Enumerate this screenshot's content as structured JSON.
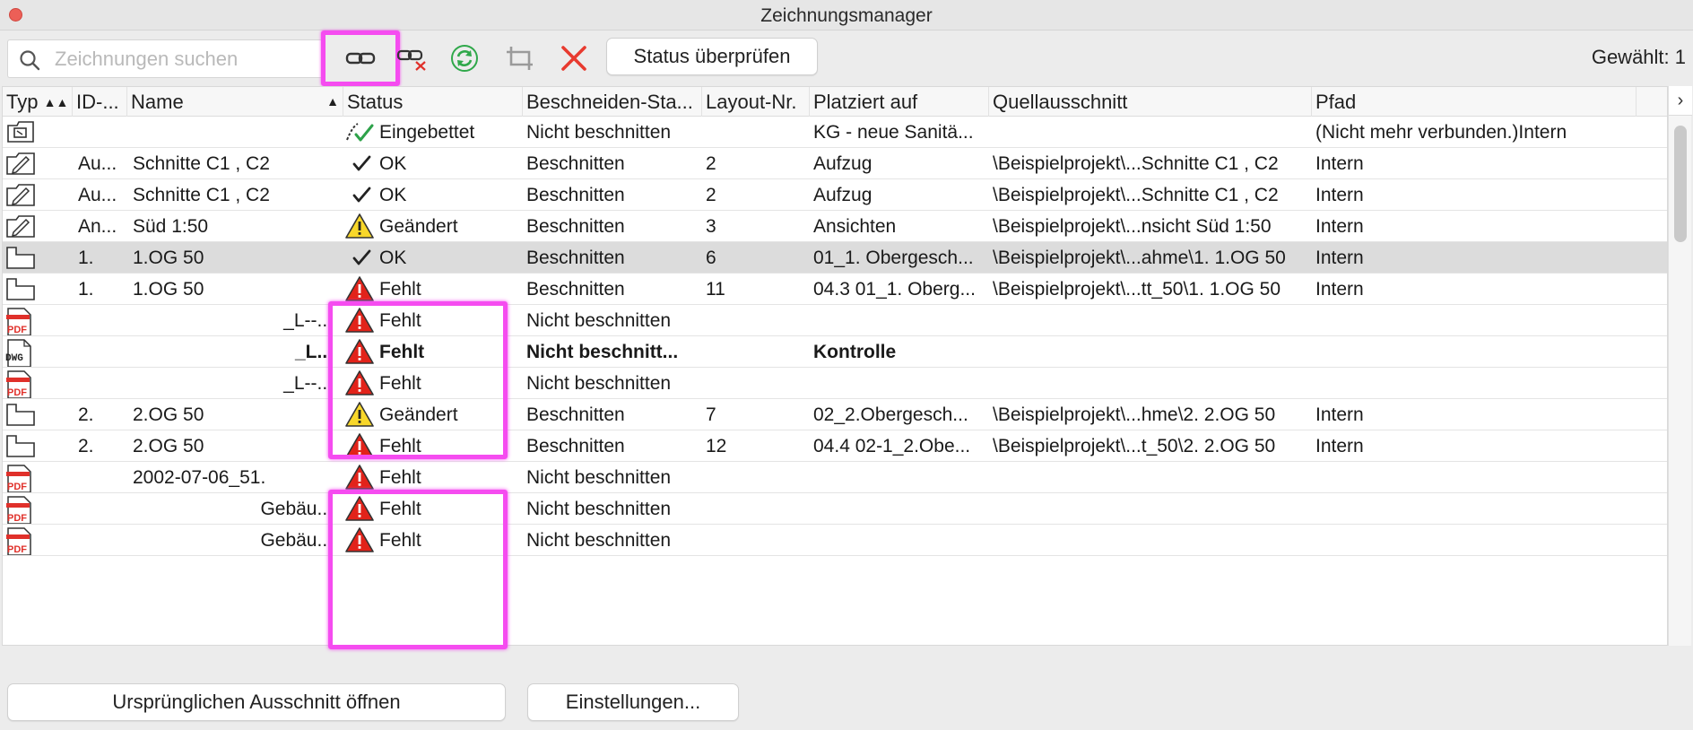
{
  "window": {
    "title": "Zeichnungsmanager"
  },
  "toolbar": {
    "search_placeholder": "Zeichnungen suchen",
    "status_button": "Status überprüfen",
    "selected_count": "Gewählt: 1",
    "tools": [
      "link-icon",
      "unlink-icon",
      "refresh-icon",
      "crop-icon",
      "delete-icon"
    ],
    "highlight_color": "#f54cf0"
  },
  "table": {
    "columns": [
      "Typ",
      "ID-...",
      "Name",
      "Status",
      "Beschneiden-Sta...",
      "Layout-Nr.",
      "Platziert auf",
      "Quellausschnitt",
      "Pfad"
    ],
    "rows": [
      {
        "type": "embedded",
        "id": "",
        "name": "",
        "status_icon": "embedded-check",
        "status": "Eingebettet",
        "crop": "Nicht beschnitten",
        "layout": "",
        "placed": "KG - neue Sanitä...",
        "source": "",
        "path": "(Nicht mehr verbunden.)Intern"
      },
      {
        "type": "drawing",
        "id": "Au...",
        "name": "Schnitte C1 , C2",
        "status_icon": "ok",
        "status": "OK",
        "crop": "Beschnitten",
        "layout": "2",
        "placed": "Aufzug",
        "source": "\\Beispielprojekt\\...Schnitte C1 , C2",
        "path": "Intern"
      },
      {
        "type": "drawing",
        "id": "Au...",
        "name": "Schnitte C1 , C2",
        "status_icon": "ok",
        "status": "OK",
        "crop": "Beschnitten",
        "layout": "2",
        "placed": "Aufzug",
        "source": "\\Beispielprojekt\\...Schnitte C1 , C2",
        "path": "Intern"
      },
      {
        "type": "drawing",
        "id": "An...",
        "name": "Süd 1:50",
        "status_icon": "changed",
        "status": "Geändert",
        "crop": "Beschnitten",
        "layout": "3",
        "placed": "Ansichten",
        "source": "\\Beispielprojekt\\...nsicht  Süd 1:50",
        "path": "Intern"
      },
      {
        "type": "plan",
        "id": "1.",
        "name": "1.OG 50",
        "status_icon": "ok",
        "status": "OK",
        "crop": "Beschnitten",
        "layout": "6",
        "placed": "01_1. Obergesch...",
        "source": "\\Beispielprojekt\\...ahme\\1. 1.OG 50",
        "path": "Intern",
        "selected": true
      },
      {
        "type": "plan",
        "id": "1.",
        "name": "1.OG 50",
        "status_icon": "missing",
        "status": "Fehlt",
        "crop": "Beschnitten",
        "layout": "11",
        "placed": "04.3 01_1. Oberg...",
        "source": "\\Beispielprojekt\\...tt_50\\1. 1.OG 50",
        "path": "Intern"
      },
      {
        "type": "pdf",
        "id": "",
        "name": "_L--...",
        "name_right": true,
        "status_icon": "missing",
        "status": "Fehlt",
        "crop": "Nicht beschnitten",
        "layout": "",
        "placed": "",
        "source": "",
        "path": ""
      },
      {
        "type": "dwg",
        "id": "",
        "name": "_L...",
        "name_right": true,
        "status_icon": "missing",
        "status": "Fehlt",
        "crop": "Nicht beschnitt...",
        "layout": "",
        "placed": "Kontrolle",
        "source": "",
        "path": "",
        "bold": true
      },
      {
        "type": "pdf",
        "id": "",
        "name": "_L--...",
        "name_right": true,
        "status_icon": "missing",
        "status": "Fehlt",
        "crop": "Nicht beschnitten",
        "layout": "",
        "placed": "",
        "source": "",
        "path": ""
      },
      {
        "type": "plan",
        "id": "2.",
        "name": "2.OG 50",
        "status_icon": "changed",
        "status": "Geändert",
        "crop": "Beschnitten",
        "layout": "7",
        "placed": "02_2.Obergesch...",
        "source": "\\Beispielprojekt\\...hme\\2. 2.OG 50",
        "path": "Intern"
      },
      {
        "type": "plan",
        "id": "2.",
        "name": "2.OG 50",
        "status_icon": "missing",
        "status": "Fehlt",
        "crop": "Beschnitten",
        "layout": "12",
        "placed": "04.4 02-1_2.Obe...",
        "source": "\\Beispielprojekt\\...t_50\\2. 2.OG 50",
        "path": "Intern"
      },
      {
        "type": "pdf",
        "id": "",
        "name": "2002-07-06_51.",
        "status_icon": "missing",
        "status": "Fehlt",
        "crop": "Nicht beschnitten",
        "layout": "",
        "placed": "",
        "source": "",
        "path": ""
      },
      {
        "type": "pdf",
        "id": "",
        "name": "Gebäu...",
        "name_right": true,
        "status_icon": "missing",
        "status": "Fehlt",
        "crop": "Nicht beschnitten",
        "layout": "",
        "placed": "",
        "source": "",
        "path": ""
      },
      {
        "type": "pdf",
        "id": "",
        "name": "Gebäu...",
        "name_right": true,
        "status_icon": "missing",
        "status": "Fehlt",
        "crop": "Nicht beschnitten",
        "layout": "",
        "placed": "",
        "source": "",
        "path": ""
      }
    ]
  },
  "footer": {
    "open_source_button": "Ursprünglichen Ausschnitt öffnen",
    "settings_button": "Einstellungen..."
  }
}
